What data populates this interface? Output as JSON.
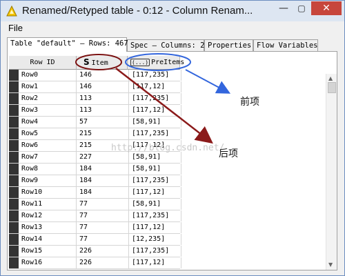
{
  "window": {
    "title": "Renamed/Retyped table - 0:12 - Column Renam...",
    "minimize_label": "—",
    "maximize_label": "▢",
    "close_label": "✕"
  },
  "menu": {
    "file": "File"
  },
  "tabs": [
    {
      "label": "Table \"default\" – Rows: 467"
    },
    {
      "label": "Spec – Columns: 2"
    },
    {
      "label": "Properties"
    },
    {
      "label": "Flow Variables"
    }
  ],
  "table": {
    "columns": [
      {
        "label": "Row ID"
      },
      {
        "label": "Item",
        "type_glyph": "S"
      },
      {
        "label": "PreItems",
        "type_glyph": "(...)"
      }
    ],
    "rows": [
      [
        "Row0",
        "146",
        "[117,235]"
      ],
      [
        "Row1",
        "146",
        "[117,12]"
      ],
      [
        "Row2",
        "113",
        "[117,235]"
      ],
      [
        "Row3",
        "113",
        "[117,12]"
      ],
      [
        "Row4",
        "57",
        "[58,91]"
      ],
      [
        "Row5",
        "215",
        "[117,235]"
      ],
      [
        "Row6",
        "215",
        "[117,12]"
      ],
      [
        "Row7",
        "227",
        "[58,91]"
      ],
      [
        "Row8",
        "184",
        "[58,91]"
      ],
      [
        "Row9",
        "184",
        "[117,235]"
      ],
      [
        "Row10",
        "184",
        "[117,12]"
      ],
      [
        "Row11",
        "77",
        "[58,91]"
      ],
      [
        "Row12",
        "77",
        "[117,235]"
      ],
      [
        "Row13",
        "77",
        "[117,12]"
      ],
      [
        "Row14",
        "77",
        "[12,235]"
      ],
      [
        "Row15",
        "226",
        "[117,235]"
      ],
      [
        "Row16",
        "226",
        "[117,12]"
      ]
    ]
  },
  "annotations": {
    "front_label": "前项",
    "back_label": "后项",
    "watermark": "http://blog.csdn.net/",
    "colors": {
      "red_ellipse": "#7a1010",
      "blue_ellipse": "#3366dd",
      "blue_arrow": "#3366dd",
      "red_arrow": "#8b1a1a"
    }
  },
  "theme": {
    "titlebar_bg": "#dde6f2",
    "close_bg": "#c7463c",
    "row_marker": "#333333"
  }
}
